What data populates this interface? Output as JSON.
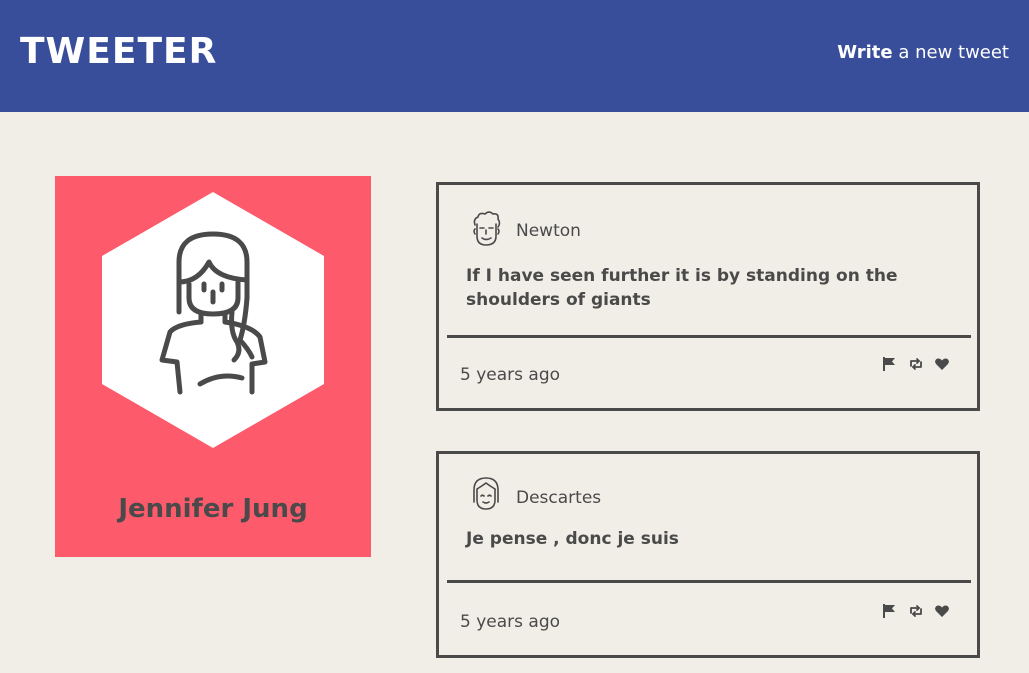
{
  "header": {
    "brand": "TWEETER",
    "compose_bold": "Write",
    "compose_rest": " a new tweet",
    "background_color": "#394e9b"
  },
  "profile": {
    "name": "Jennifer Jung",
    "avatar_icon": "woman-avatar-icon",
    "background_color": "#fd5a6c"
  },
  "tweets": [
    {
      "author": "Newton",
      "avatar_icon": "curly-hair-man-avatar-icon",
      "text": "If I have seen further it is by standing on the shoulders of giants",
      "time": "5 years ago",
      "actions": [
        "flag-icon",
        "retweet-icon",
        "heart-icon"
      ]
    },
    {
      "author": "Descartes",
      "avatar_icon": "bangs-woman-avatar-icon",
      "text": "Je pense , donc je suis",
      "time": "5 years ago",
      "actions": [
        "flag-icon",
        "retweet-icon",
        "heart-icon"
      ]
    }
  ]
}
